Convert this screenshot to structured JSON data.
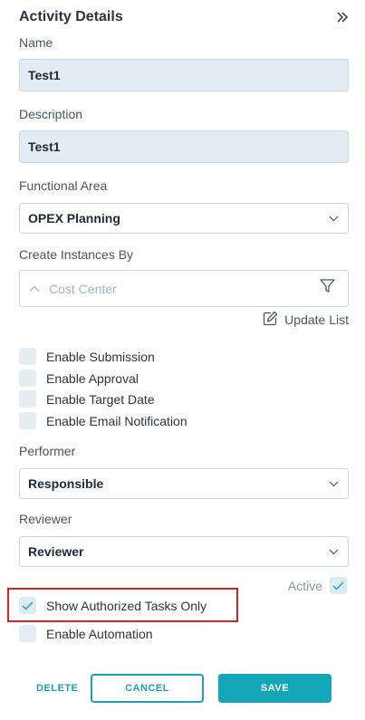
{
  "panel": {
    "title": "Activity Details",
    "collapse_icon": "double-chevron-right-icon"
  },
  "name": {
    "label": "Name",
    "value": "Test1"
  },
  "description": {
    "label": "Description",
    "value": "Test1"
  },
  "functional_area": {
    "label": "Functional Area",
    "value": "OPEX Planning"
  },
  "create_instances": {
    "label": "Create Instances By",
    "placeholder": "Cost Center",
    "update_label": "Update List"
  },
  "options": [
    {
      "label": "Enable Submission",
      "checked": false
    },
    {
      "label": "Enable Approval",
      "checked": false
    },
    {
      "label": "Enable Target Date",
      "checked": false
    },
    {
      "label": "Enable Email Notification",
      "checked": false
    }
  ],
  "performer": {
    "label": "Performer",
    "value": "Responsible"
  },
  "reviewer": {
    "label": "Reviewer",
    "value": "Reviewer"
  },
  "active": {
    "label": "Active",
    "checked": true
  },
  "authorized_tasks": {
    "label": "Show Authorized Tasks Only",
    "checked": true
  },
  "automation": {
    "label": "Enable Automation",
    "checked": false
  },
  "actions": {
    "delete": "DELETE",
    "cancel": "CANCEL",
    "save": "SAVE"
  },
  "colors": {
    "accent": "#13a6b8",
    "highlight": "#e0201f",
    "field_bg": "#e3ecf5"
  }
}
